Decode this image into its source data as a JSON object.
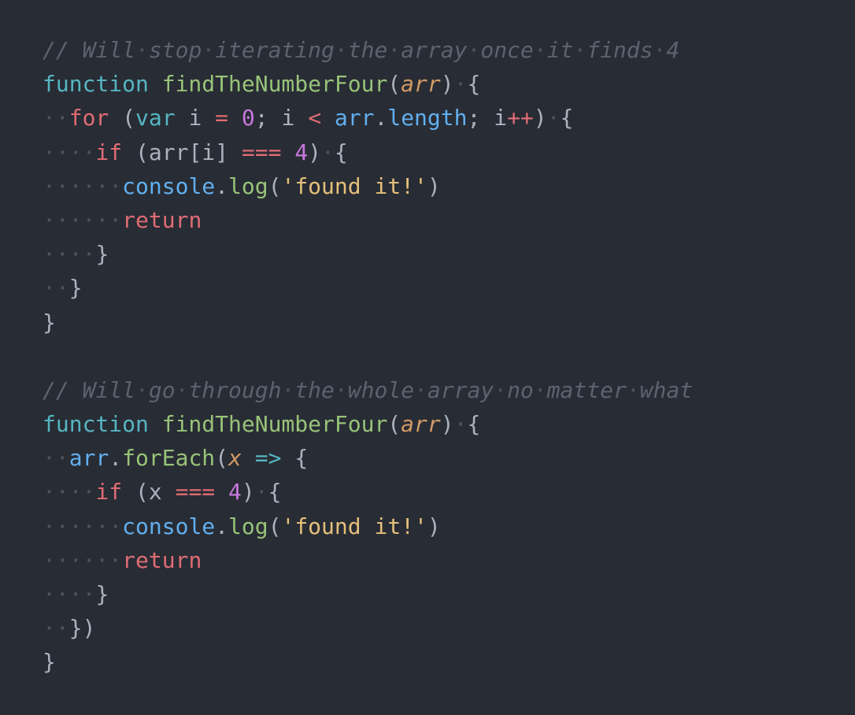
{
  "editor": {
    "theme_colors": {
      "background": "#282c34",
      "comment": "#5c6370",
      "keyword": "#e06c75",
      "storage": "#56b6c2",
      "function_name": "#98c379",
      "parameter": "#d19a66",
      "number": "#c678dd",
      "string": "#e5c07b",
      "identifier": "#61afef",
      "punctuation": "#abb2bf",
      "whitespace_marker": "#4b5263"
    },
    "lines": [
      [
        {
          "t": "// Will",
          "k": "c-comment"
        },
        {
          "t": "·",
          "k": "ws"
        },
        {
          "t": "stop",
          "k": "c-comment"
        },
        {
          "t": "·",
          "k": "ws"
        },
        {
          "t": "iterating",
          "k": "c-comment"
        },
        {
          "t": "·",
          "k": "ws"
        },
        {
          "t": "the",
          "k": "c-comment"
        },
        {
          "t": "·",
          "k": "ws"
        },
        {
          "t": "array",
          "k": "c-comment"
        },
        {
          "t": "·",
          "k": "ws"
        },
        {
          "t": "once",
          "k": "c-comment"
        },
        {
          "t": "·",
          "k": "ws"
        },
        {
          "t": "it",
          "k": "c-comment"
        },
        {
          "t": "·",
          "k": "ws"
        },
        {
          "t": "finds",
          "k": "c-comment"
        },
        {
          "t": "·",
          "k": "ws"
        },
        {
          "t": "4",
          "k": "c-comment"
        }
      ],
      [
        {
          "t": "function",
          "k": "c-storage"
        },
        {
          "t": " ",
          "k": "c-punc"
        },
        {
          "t": "findTheNumberFour",
          "k": "c-func"
        },
        {
          "t": "(",
          "k": "c-punc"
        },
        {
          "t": "arr",
          "k": "c-param"
        },
        {
          "t": ")",
          "k": "c-punc"
        },
        {
          "t": "·",
          "k": "ws"
        },
        {
          "t": "{",
          "k": "c-punc"
        }
      ],
      [
        {
          "t": "··",
          "k": "ws"
        },
        {
          "t": "for",
          "k": "c-keyword"
        },
        {
          "t": " (",
          "k": "c-punc"
        },
        {
          "t": "var",
          "k": "c-storage"
        },
        {
          "t": " ",
          "k": "c-punc"
        },
        {
          "t": "i",
          "k": "c-punc"
        },
        {
          "t": " ",
          "k": "c-punc"
        },
        {
          "t": "=",
          "k": "c-op"
        },
        {
          "t": " ",
          "k": "c-punc"
        },
        {
          "t": "0",
          "k": "c-number"
        },
        {
          "t": "; i ",
          "k": "c-punc"
        },
        {
          "t": "<",
          "k": "c-op"
        },
        {
          "t": " ",
          "k": "c-punc"
        },
        {
          "t": "arr",
          "k": "c-obj"
        },
        {
          "t": ".",
          "k": "c-punc"
        },
        {
          "t": "length",
          "k": "c-prop"
        },
        {
          "t": "; i",
          "k": "c-punc"
        },
        {
          "t": "++",
          "k": "c-op"
        },
        {
          "t": ")",
          "k": "c-punc"
        },
        {
          "t": "·",
          "k": "ws"
        },
        {
          "t": "{",
          "k": "c-punc"
        }
      ],
      [
        {
          "t": "····",
          "k": "ws"
        },
        {
          "t": "if",
          "k": "c-keyword"
        },
        {
          "t": " (arr[i] ",
          "k": "c-punc"
        },
        {
          "t": "===",
          "k": "c-op"
        },
        {
          "t": " ",
          "k": "c-punc"
        },
        {
          "t": "4",
          "k": "c-number"
        },
        {
          "t": ")",
          "k": "c-punc"
        },
        {
          "t": "·",
          "k": "ws"
        },
        {
          "t": "{",
          "k": "c-punc"
        }
      ],
      [
        {
          "t": "······",
          "k": "ws"
        },
        {
          "t": "console",
          "k": "c-obj"
        },
        {
          "t": ".",
          "k": "c-punc"
        },
        {
          "t": "log",
          "k": "c-func"
        },
        {
          "t": "(",
          "k": "c-punc"
        },
        {
          "t": "'found it!'",
          "k": "c-string"
        },
        {
          "t": ")",
          "k": "c-punc"
        }
      ],
      [
        {
          "t": "······",
          "k": "ws"
        },
        {
          "t": "return",
          "k": "c-keyword"
        }
      ],
      [
        {
          "t": "····",
          "k": "ws"
        },
        {
          "t": "}",
          "k": "c-punc"
        }
      ],
      [
        {
          "t": "··",
          "k": "ws"
        },
        {
          "t": "}",
          "k": "c-punc"
        }
      ],
      [
        {
          "t": "}",
          "k": "c-punc"
        }
      ],
      [],
      [
        {
          "t": "// Will",
          "k": "c-comment"
        },
        {
          "t": "·",
          "k": "ws"
        },
        {
          "t": "go",
          "k": "c-comment"
        },
        {
          "t": "·",
          "k": "ws"
        },
        {
          "t": "through",
          "k": "c-comment"
        },
        {
          "t": "·",
          "k": "ws"
        },
        {
          "t": "the",
          "k": "c-comment"
        },
        {
          "t": "·",
          "k": "ws"
        },
        {
          "t": "whole",
          "k": "c-comment"
        },
        {
          "t": "·",
          "k": "ws"
        },
        {
          "t": "array",
          "k": "c-comment"
        },
        {
          "t": "·",
          "k": "ws"
        },
        {
          "t": "no",
          "k": "c-comment"
        },
        {
          "t": "·",
          "k": "ws"
        },
        {
          "t": "matter",
          "k": "c-comment"
        },
        {
          "t": "·",
          "k": "ws"
        },
        {
          "t": "what",
          "k": "c-comment"
        }
      ],
      [
        {
          "t": "function",
          "k": "c-storage"
        },
        {
          "t": " ",
          "k": "c-punc"
        },
        {
          "t": "findTheNumberFour",
          "k": "c-func"
        },
        {
          "t": "(",
          "k": "c-punc"
        },
        {
          "t": "arr",
          "k": "c-param"
        },
        {
          "t": ")",
          "k": "c-punc"
        },
        {
          "t": "·",
          "k": "ws"
        },
        {
          "t": "{",
          "k": "c-punc"
        }
      ],
      [
        {
          "t": "··",
          "k": "ws"
        },
        {
          "t": "arr",
          "k": "c-obj"
        },
        {
          "t": ".",
          "k": "c-punc"
        },
        {
          "t": "forEach",
          "k": "c-func"
        },
        {
          "t": "(",
          "k": "c-punc"
        },
        {
          "t": "x",
          "k": "c-param"
        },
        {
          "t": " ",
          "k": "c-punc"
        },
        {
          "t": "=>",
          "k": "c-arrow"
        },
        {
          "t": " {",
          "k": "c-punc"
        }
      ],
      [
        {
          "t": "····",
          "k": "ws"
        },
        {
          "t": "if",
          "k": "c-keyword"
        },
        {
          "t": " (x ",
          "k": "c-punc"
        },
        {
          "t": "===",
          "k": "c-op"
        },
        {
          "t": " ",
          "k": "c-punc"
        },
        {
          "t": "4",
          "k": "c-number"
        },
        {
          "t": ")",
          "k": "c-punc"
        },
        {
          "t": "·",
          "k": "ws"
        },
        {
          "t": "{",
          "k": "c-punc"
        }
      ],
      [
        {
          "t": "······",
          "k": "ws"
        },
        {
          "t": "console",
          "k": "c-obj"
        },
        {
          "t": ".",
          "k": "c-punc"
        },
        {
          "t": "log",
          "k": "c-func"
        },
        {
          "t": "(",
          "k": "c-punc"
        },
        {
          "t": "'found it!'",
          "k": "c-string"
        },
        {
          "t": ")",
          "k": "c-punc"
        }
      ],
      [
        {
          "t": "······",
          "k": "ws"
        },
        {
          "t": "return",
          "k": "c-keyword"
        }
      ],
      [
        {
          "t": "····",
          "k": "ws"
        },
        {
          "t": "}",
          "k": "c-punc"
        }
      ],
      [
        {
          "t": "··",
          "k": "ws"
        },
        {
          "t": "})",
          "k": "c-punc"
        }
      ],
      [
        {
          "t": "}",
          "k": "c-punc"
        }
      ]
    ]
  }
}
